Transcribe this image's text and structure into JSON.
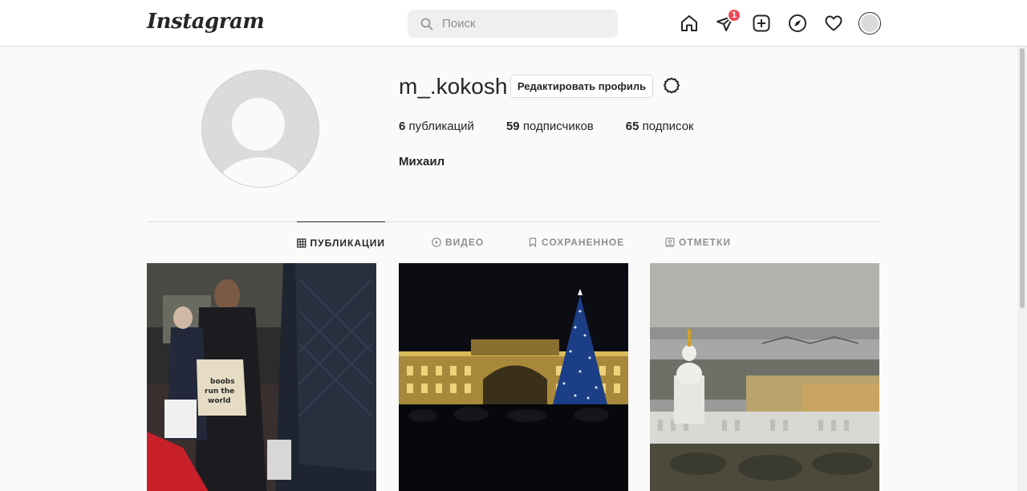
{
  "app": {
    "logo": "Instagram"
  },
  "search": {
    "placeholder": "Поиск"
  },
  "nav": {
    "direct_badge": "1",
    "icons": [
      "home-icon",
      "direct-icon",
      "new-post-icon",
      "explore-icon",
      "activity-icon",
      "avatar"
    ]
  },
  "profile": {
    "username": "m_.kokosh",
    "edit_button": "Редактировать профиль",
    "stats": [
      {
        "count": "6",
        "label": "публикаций"
      },
      {
        "count": "59",
        "label": "подписчиков"
      },
      {
        "count": "65",
        "label": "подписок"
      }
    ],
    "full_name": "Михаил"
  },
  "tabs": [
    {
      "label": "ПУБЛИКАЦИИ",
      "icon": "grid-icon",
      "active": true
    },
    {
      "label": "ВИДЕО",
      "icon": "play-icon",
      "active": false
    },
    {
      "label": "СОХРАНЕННОЕ",
      "icon": "bookmark-icon",
      "active": false
    },
    {
      "label": "ОТМЕТКИ",
      "icon": "tagged-icon",
      "active": false
    }
  ],
  "posts": [
    {
      "subject": "people in subway car",
      "bag_text": "boobs run the world"
    },
    {
      "subject": "palace square with christmas tree at night"
    },
    {
      "subject": "cathedral and river panorama"
    }
  ]
}
